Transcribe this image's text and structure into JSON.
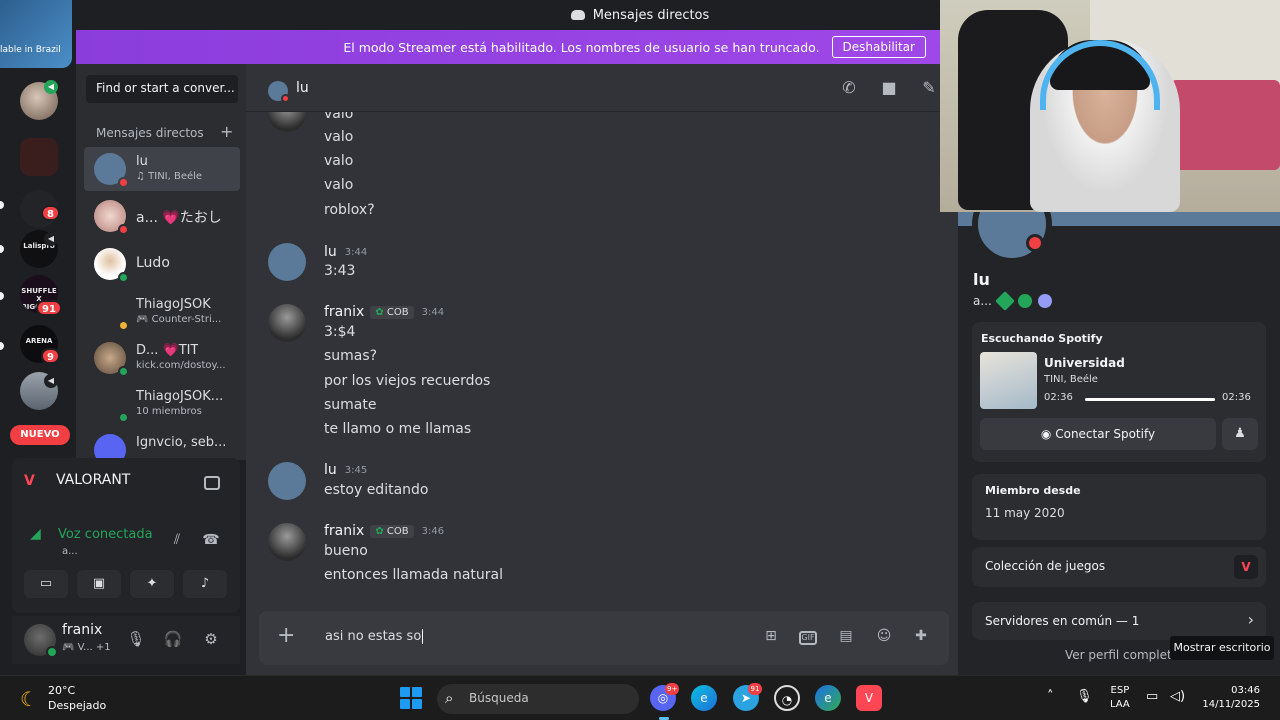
{
  "window": {
    "title": "Mensajes directos"
  },
  "rail": {
    "promo_text": "lable in Brazil",
    "servers": [
      {
        "name": "server-1"
      },
      {
        "name": "server-2"
      },
      {
        "name": "server-3",
        "badge": "8"
      },
      {
        "name": "server-4",
        "text": "Lalispro"
      },
      {
        "name": "server-5",
        "text": "SHUFFLE X BIGCARA",
        "badge": "91"
      },
      {
        "name": "server-6",
        "text": "ARENA",
        "badge": "9"
      },
      {
        "name": "server-7"
      }
    ],
    "new_label": "NUEVO"
  },
  "banner": {
    "text": "El modo Streamer está habilitado. Los nombres de usuario se han truncado.",
    "button": "Deshabilitar"
  },
  "sidebar": {
    "search_placeholder": "Find or start a conver...",
    "header": "Mensajes directos",
    "dms": [
      {
        "name": "lu",
        "sub": "♫ TINI, Beéle",
        "status": "dnd",
        "active": true
      },
      {
        "name": "a... 💗たおし",
        "sub": "",
        "status": "dnd"
      },
      {
        "name": "Ludo",
        "sub": "",
        "status": "online"
      },
      {
        "name": "ThiagoJSOK",
        "sub": "🎮 Counter-Stri...",
        "status": "idle"
      },
      {
        "name": "D... 💗TIT",
        "sub": "kick.com/dostoy...",
        "status": "online"
      },
      {
        "name": "ThiagoJSOK...",
        "sub": "10 miembros",
        "status": "group"
      },
      {
        "name": "Ignvcio, seb...",
        "sub": "",
        "status": "group"
      }
    ]
  },
  "voice": {
    "game": "VALORANT",
    "status": "Voz conectada",
    "channel": "a..."
  },
  "user": {
    "name": "franix",
    "sub": "🎮 V... +1"
  },
  "chat": {
    "recipient": "lu",
    "top_lines": [
      "valo",
      "valo",
      "valo",
      "valo",
      "roblox?"
    ],
    "groups": [
      {
        "author": "lu",
        "time": "3:44",
        "tag": "",
        "lines": [
          "3:43"
        ]
      },
      {
        "author": "franix",
        "time": "3:44",
        "tag": "COB",
        "lines": [
          "3:$4",
          "sumas?",
          "por los viejos recuerdos",
          "sumate",
          "te llamo o me llamas"
        ]
      },
      {
        "author": "lu",
        "time": "3:45",
        "tag": "",
        "lines": [
          "estoy editando"
        ]
      },
      {
        "author": "franix",
        "time": "3:46",
        "tag": "COB",
        "lines": [
          "bueno",
          "entonces llamada natural"
        ]
      }
    ],
    "draft": "asi no estas so"
  },
  "profile": {
    "name": "lu",
    "sub": "a...",
    "spotify_header": "Escuchando Spotify",
    "track": "Universidad",
    "artist": "TINI, Beéle",
    "time_elapsed": "02:36",
    "time_total": "02:36",
    "progress": 1.0,
    "connect_label": "Conectar Spotify",
    "member_since_label": "Miembro desde",
    "member_since": "11 may 2020",
    "games_label": "Colección de juegos",
    "servers_label": "Servidores en común — 1",
    "full_profile": "Ver perfil completo",
    "tooltip": "Mostrar escritorio"
  },
  "taskbar": {
    "temp": "20°C",
    "condition": "Despejado",
    "search": "Búsqueda",
    "discord_badge": "9+",
    "telegram_badge": "91",
    "lang": "ESP",
    "lang2": "LAA",
    "time": "03:46",
    "date": "14/11/2025"
  }
}
